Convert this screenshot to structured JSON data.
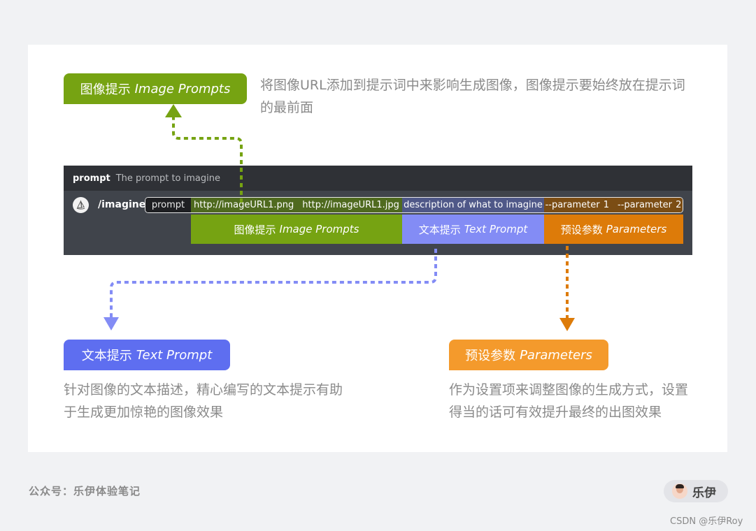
{
  "colors": {
    "image_prompt": "#76a312",
    "text_prompt": "#5e6ef0",
    "text_prompt_band": "#838cf5",
    "parameters": "#f49a2c",
    "parameters_band": "#dd7b09",
    "discord_bg": "#40444b",
    "page_bg": "#f1f2f4"
  },
  "callouts": {
    "image_prompts": {
      "label_cn": "图像提示",
      "label_en": "Image Prompts",
      "description": "将图像URL添加到提示词中来影响生成图像，图像提示要始终放在提示词的最前面"
    },
    "text_prompt": {
      "label_cn": "文本提示",
      "label_en": "Text Prompt",
      "description": "针对图像的文本描述，精心编写的文本提示有助于生成更加惊艳的图像效果"
    },
    "parameters": {
      "label_cn": "预设参数",
      "label_en": "Parameters",
      "description": "作为设置项来调整图像的生成方式，设置得当的话可有效提升最终的出图效果"
    }
  },
  "discord": {
    "header_name": "prompt",
    "header_hint": "The prompt to imagine",
    "bot_icon": "midjourney-boat-icon",
    "command": "/imagine",
    "input": {
      "prompt_label": "prompt",
      "urls": [
        "http://imageURL1.png",
        "http://imageURL1.jpg"
      ],
      "description": "description of what to imagine",
      "params": [
        "--parameter 1",
        "--parameter 2"
      ]
    },
    "bands": {
      "image_cn": "图像提示",
      "image_en": "Image Prompts",
      "text_cn": "文本提示",
      "text_en": "Text Prompt",
      "param_cn": "预设参数",
      "param_en": "Parameters"
    }
  },
  "footer": {
    "account": "公众号：乐伊体验笔记",
    "author_name": "乐伊",
    "watermark": "CSDN @乐伊Roy"
  }
}
